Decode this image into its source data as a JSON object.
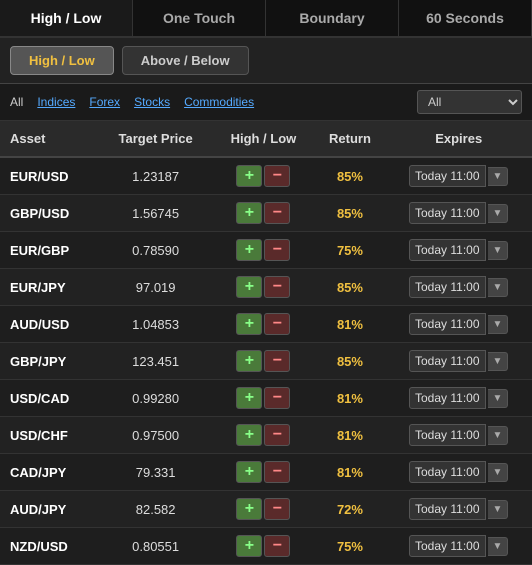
{
  "topTabs": [
    {
      "id": "high-low",
      "label": "High / Low",
      "active": true
    },
    {
      "id": "one-touch",
      "label": "One Touch",
      "active": false
    },
    {
      "id": "boundary",
      "label": "Boundary",
      "active": false
    },
    {
      "id": "60-seconds",
      "label": "60 Seconds",
      "active": false
    }
  ],
  "subTabs": [
    {
      "id": "high-low-sub",
      "label": "High / Low",
      "active": true
    },
    {
      "id": "above-below",
      "label": "Above / Below",
      "active": false
    }
  ],
  "filters": [
    {
      "id": "all",
      "label": "All",
      "active": true
    },
    {
      "id": "indices",
      "label": "Indices",
      "active": false
    },
    {
      "id": "forex",
      "label": "Forex",
      "active": false
    },
    {
      "id": "stocks",
      "label": "Stocks",
      "active": false
    },
    {
      "id": "commodities",
      "label": "Commodities",
      "active": false
    }
  ],
  "filterSelectOptions": [
    "All",
    "Forex",
    "Indices",
    "Stocks",
    "Commodities"
  ],
  "filterSelectValue": "All",
  "tableHeaders": [
    "Asset",
    "Target Price",
    "High / Low",
    "Return",
    "Expires"
  ],
  "rows": [
    {
      "asset": "EUR/USD",
      "price": "1.23187",
      "return": "85%",
      "expires": "Today 11:00"
    },
    {
      "asset": "GBP/USD",
      "price": "1.56745",
      "return": "85%",
      "expires": "Today 11:00"
    },
    {
      "asset": "EUR/GBP",
      "price": "0.78590",
      "return": "75%",
      "expires": "Today 11:00"
    },
    {
      "asset": "EUR/JPY",
      "price": "97.019",
      "return": "85%",
      "expires": "Today 11:00"
    },
    {
      "asset": "AUD/USD",
      "price": "1.04853",
      "return": "81%",
      "expires": "Today 11:00"
    },
    {
      "asset": "GBP/JPY",
      "price": "123.451",
      "return": "85%",
      "expires": "Today 11:00"
    },
    {
      "asset": "USD/CAD",
      "price": "0.99280",
      "return": "81%",
      "expires": "Today 11:00"
    },
    {
      "asset": "USD/CHF",
      "price": "0.97500",
      "return": "81%",
      "expires": "Today 11:00"
    },
    {
      "asset": "CAD/JPY",
      "price": "79.331",
      "return": "81%",
      "expires": "Today 11:00"
    },
    {
      "asset": "AUD/JPY",
      "price": "82.582",
      "return": "72%",
      "expires": "Today 11:00"
    },
    {
      "asset": "NZD/USD",
      "price": "0.80551",
      "return": "75%",
      "expires": "Today 11:00"
    }
  ],
  "plusLabel": "+",
  "minusLabel": "−"
}
